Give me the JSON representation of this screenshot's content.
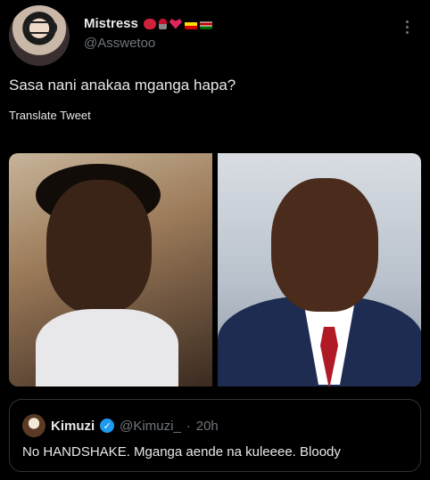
{
  "author": {
    "display_name": "Mistress",
    "username": "@Asswetoo",
    "emojis": [
      "lips-icon",
      "wine-glass-icon",
      "red-heart-icon",
      "uganda-flag-icon",
      "kenya-flag-icon"
    ]
  },
  "tweet": {
    "text": "Sasa nani anakaa mganga hapa?",
    "translate_label": "Translate Tweet"
  },
  "quoted_tweet": {
    "display_name": "Kimuzi",
    "verified": true,
    "username": "@Kimuzi_",
    "separator": "·",
    "time": "20h",
    "text": "No HANDSHAKE. Mganga aende na kuleeee. Bloody"
  },
  "colors": {
    "background": "#000000",
    "text_primary": "#e7e9ea",
    "text_secondary": "#71767b",
    "verified_badge": "#1d9bf0",
    "border": "#2f3336"
  }
}
